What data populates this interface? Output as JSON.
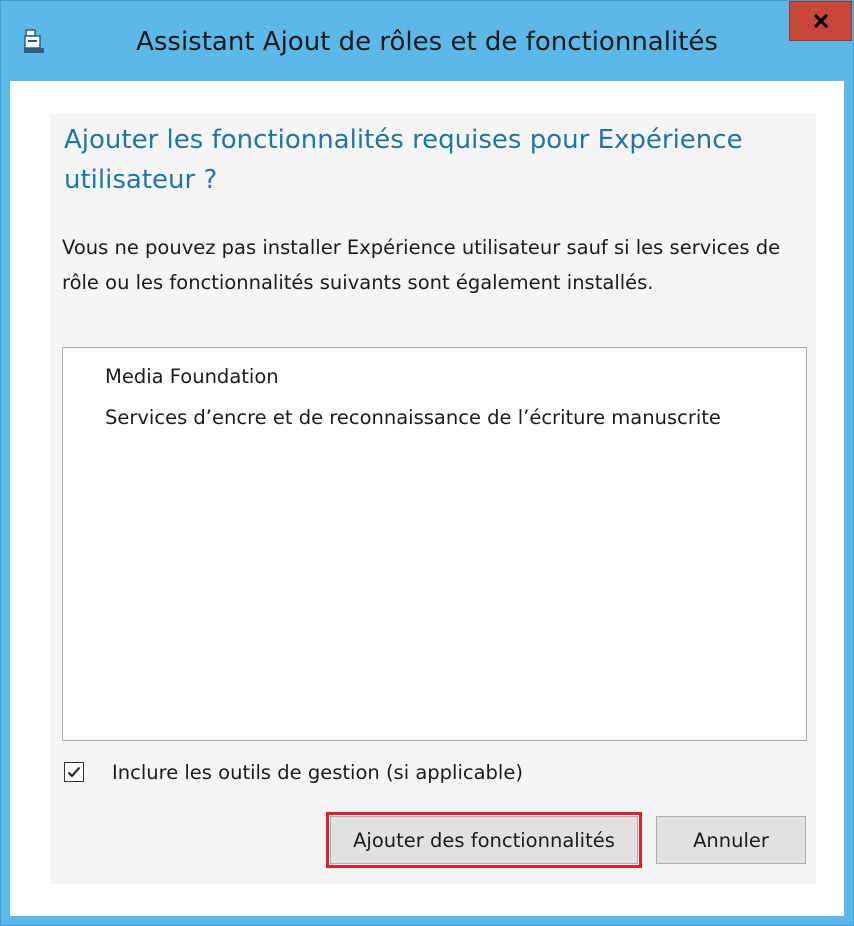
{
  "window": {
    "title": "Assistant Ajout de rôles et de fonctionnalités",
    "icon": "server-manager-icon",
    "close_glyph": "x",
    "title_bar_color": "#5cb8e8",
    "close_button_color": "#c7473a"
  },
  "dialog": {
    "heading": "Ajouter les fonctionnalités requises pour Expérience utilisateur ?",
    "heading_color": "#1e76a7",
    "message": "Vous ne pouvez pas installer Expérience utilisateur sauf si les services de rôle ou les fonctionnalités suivants sont également installés.",
    "required_features": [
      "Media Foundation",
      "Services d’encre et de reconnaissance de l’écriture manuscrite"
    ],
    "include_tools": {
      "label": "Inclure les outils de gestion (si applicable)",
      "checked": true
    },
    "buttons": {
      "add": "Ajouter des fonctionnalités",
      "cancel": "Annuler"
    },
    "highlight_color": "#e8202a"
  }
}
